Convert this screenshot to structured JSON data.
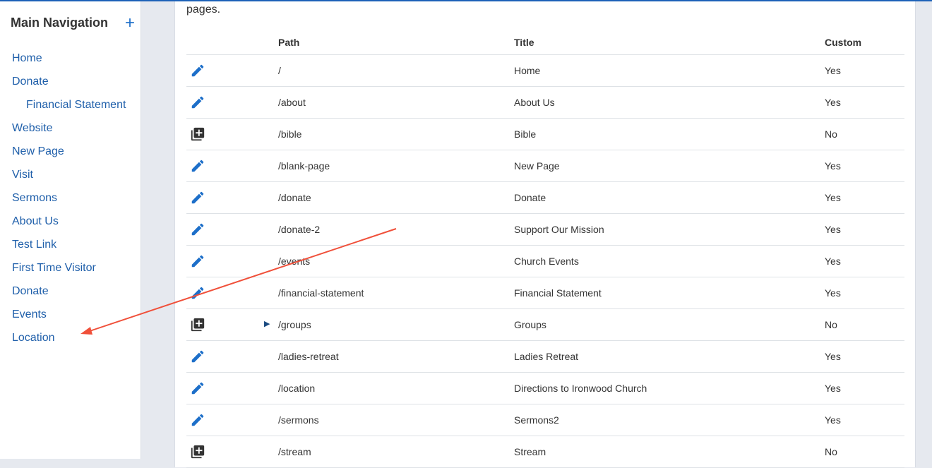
{
  "sidebar": {
    "title": "Main Navigation",
    "add_label": "+",
    "items": [
      {
        "label": "Home"
      },
      {
        "label": "Donate"
      },
      {
        "label": "Financial Statement"
      },
      {
        "label": "Website"
      },
      {
        "label": "New Page"
      },
      {
        "label": "Visit"
      },
      {
        "label": "Sermons"
      },
      {
        "label": "About Us"
      },
      {
        "label": "Test Link"
      },
      {
        "label": "First Time Visitor"
      },
      {
        "label": "Donate"
      },
      {
        "label": "Events"
      },
      {
        "label": "Location"
      }
    ]
  },
  "main": {
    "intro_text": "pages.",
    "columns": {
      "path": "Path",
      "title": "Title",
      "custom": "Custom"
    },
    "rows": [
      {
        "icon": "pencil-icon",
        "path": "/",
        "title": "Home",
        "custom": "Yes"
      },
      {
        "icon": "pencil-icon",
        "path": "/about",
        "title": "About Us",
        "custom": "Yes"
      },
      {
        "icon": "add-page-icon",
        "path": "/bible",
        "title": "Bible",
        "custom": "No"
      },
      {
        "icon": "pencil-icon",
        "path": "/blank-page",
        "title": "New Page",
        "custom": "Yes"
      },
      {
        "icon": "pencil-icon",
        "path": "/donate",
        "title": "Donate",
        "custom": "Yes"
      },
      {
        "icon": "pencil-icon",
        "path": "/donate-2",
        "title": "Support Our Mission",
        "custom": "Yes"
      },
      {
        "icon": "pencil-icon",
        "path": "/events",
        "title": "Church Events",
        "custom": "Yes"
      },
      {
        "icon": "pencil-icon",
        "path": "/financial-statement",
        "title": "Financial Statement",
        "custom": "Yes"
      },
      {
        "icon": "add-page-icon",
        "path": "/groups",
        "title": "Groups",
        "custom": "No",
        "expand": "▶"
      },
      {
        "icon": "pencil-icon",
        "path": "/ladies-retreat",
        "title": "Ladies Retreat",
        "custom": "Yes"
      },
      {
        "icon": "pencil-icon",
        "path": "/location",
        "title": "Directions to Ironwood Church",
        "custom": "Yes"
      },
      {
        "icon": "pencil-icon",
        "path": "/sermons",
        "title": "Sermons2",
        "custom": "Yes"
      },
      {
        "icon": "add-page-icon",
        "path": "/stream",
        "title": "Stream",
        "custom": "No"
      }
    ]
  },
  "colors": {
    "accent": "#1d6fc9",
    "link": "#1f5faa",
    "annotation_arrow": "#f0503a",
    "background": "#e6e9ef"
  }
}
